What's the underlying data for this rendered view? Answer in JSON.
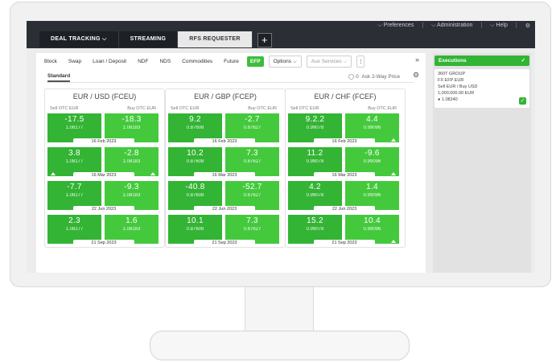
{
  "top_menu": [
    "Preferences",
    "Administration",
    "Help"
  ],
  "tabs": [
    {
      "label": "DEAL TRACKING",
      "has_chevron": true,
      "active": false
    },
    {
      "label": "STREAMING",
      "has_chevron": false,
      "active": false
    },
    {
      "label": "RFS REQUESTER",
      "has_chevron": false,
      "active": true
    }
  ],
  "add_tab": "+",
  "products": [
    "Block",
    "Swap",
    "Loan / Deposit",
    "NDF",
    "NDS",
    "Commodities",
    "Future",
    "EFP"
  ],
  "active_product": "EFP",
  "options_label": "Options",
  "aux_services_label": "Aux Services",
  "kebab": "⋮",
  "collapse_icon": "»",
  "standard_tab": "Standard",
  "ask_label": "Ask 2-Way Price",
  "toggle_value": "0",
  "cards": [
    {
      "title": "EUR / USD (FCEU)",
      "sell_label": "Sell OTC EUR",
      "buy_label": "Buy OTC EUR",
      "rows": [
        {
          "sell_pts": "-17.5",
          "sell_rate": "1.08177",
          "buy_pts": "-18.3",
          "buy_rate": "1.08183",
          "date": "16 Feb 2023",
          "sell_tri": false,
          "buy_tri": false
        },
        {
          "sell_pts": "3.8",
          "sell_rate": "1.08177",
          "buy_pts": "-2.8",
          "buy_rate": "1.08183",
          "date": "16 Mar 2023",
          "sell_tri": true,
          "buy_tri": true
        },
        {
          "sell_pts": "-7.7",
          "sell_rate": "1.08177",
          "buy_pts": "-9.3",
          "buy_rate": "1.08183",
          "date": "22 Jun 2023",
          "sell_tri": false,
          "buy_tri": false
        },
        {
          "sell_pts": "2.3",
          "sell_rate": "1.08177",
          "buy_pts": "1.6",
          "buy_rate": "1.08183",
          "date": "21 Sep 2023",
          "sell_tri": false,
          "buy_tri": false
        }
      ]
    },
    {
      "title": "EUR / GBP (FCEP)",
      "sell_label": "Sell OTC EUR",
      "buy_label": "Buy OTC EUR",
      "rows": [
        {
          "sell_pts": "9.2",
          "sell_rate": "0.87608",
          "buy_pts": "-2.7",
          "buy_rate": "0.87627",
          "date": "16 Feb 2023",
          "sell_tri": false,
          "buy_tri": false
        },
        {
          "sell_pts": "10.2",
          "sell_rate": "0.87608",
          "buy_pts": "7.3",
          "buy_rate": "0.87627",
          "date": "16 Mar 2023",
          "sell_tri": false,
          "buy_tri": false
        },
        {
          "sell_pts": "-40.8",
          "sell_rate": "0.87608",
          "buy_pts": "-52.7",
          "buy_rate": "0.87627",
          "date": "22 Jun 2023",
          "sell_tri": false,
          "buy_tri": false
        },
        {
          "sell_pts": "10.1",
          "sell_rate": "0.87608",
          "buy_pts": "7.3",
          "buy_rate": "0.87627",
          "date": "21 Sep 2023",
          "sell_tri": false,
          "buy_tri": false
        }
      ]
    },
    {
      "title": "EUR / CHF (FCEF)",
      "sell_label": "Sell OTC EUR",
      "buy_label": "Buy OTC EUR",
      "rows": [
        {
          "sell_pts": "9.2.2",
          "sell_rate": "0.99078",
          "buy_pts": "4.4",
          "buy_rate": "0.99096",
          "date": "16 Feb 2023",
          "sell_tri": false,
          "buy_tri": true
        },
        {
          "sell_pts": "11.2",
          "sell_rate": "0.99078",
          "buy_pts": "-9.6",
          "buy_rate": "0.99096",
          "date": "16 Mar 2023",
          "sell_tri": false,
          "buy_tri": true
        },
        {
          "sell_pts": "4.2",
          "sell_rate": "0.99078",
          "buy_pts": "1.4",
          "buy_rate": "0.99096",
          "date": "22 Jun 2023",
          "sell_tri": false,
          "buy_tri": false
        },
        {
          "sell_pts": "15.2",
          "sell_rate": "0.99078",
          "buy_pts": "10.4",
          "buy_rate": "0.99096",
          "date": "21 Sep 2023",
          "sell_tri": false,
          "buy_tri": true
        }
      ]
    }
  ],
  "executions": {
    "title": "Executions",
    "check": "✓",
    "card": {
      "group": "360T GROUP",
      "product": "FX EFP EUR",
      "side": "Sell EUR / Buy USD",
      "amount": "1,000,000.00 EUR",
      "rate": "1.08240"
    }
  },
  "colors": {
    "accent": "#33b434",
    "topbar": "#2b2f35"
  }
}
